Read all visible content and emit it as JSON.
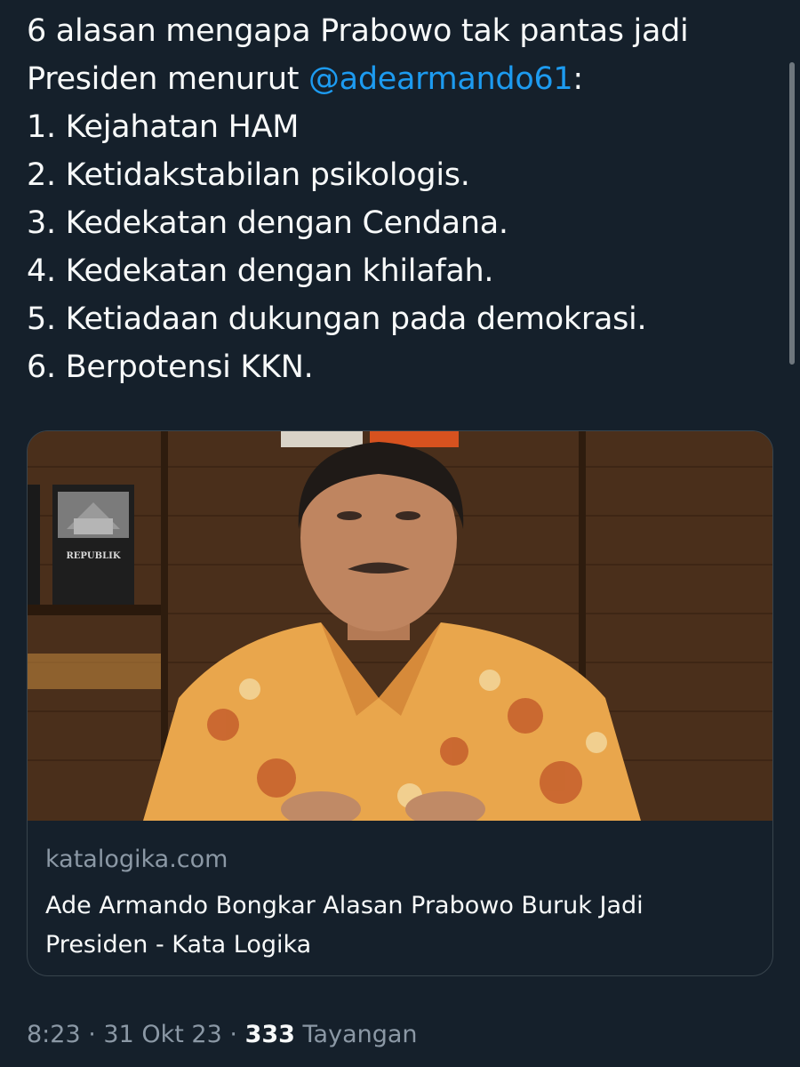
{
  "tweet": {
    "line1": "6 alasan mengapa Prabowo tak pantas jadi",
    "line2_prefix": "Presiden menurut ",
    "mention": "@adearmando61",
    "line2_suffix": ":",
    "list": [
      "1. Kejahatan HAM",
      "2. Ketidakstabilan psikologis.",
      "3. Kedekatan dengan Cendana.",
      "4. Kedekatan dengan khilafah.",
      "5. Ketiadaan dukungan pada demokrasi.",
      "6. Berpotensi KKN."
    ]
  },
  "card": {
    "book_title": "REPUBLIK",
    "domain": "katalogika.com",
    "title_line1": "Ade Armando Bongkar Alasan Prabowo Buruk Jadi",
    "title_line2": "Presiden - Kata Logika"
  },
  "meta": {
    "time": "8:23",
    "separator": "·",
    "date": "31 Okt 23",
    "views_count": "333",
    "views_label": "Tayangan"
  },
  "colors": {
    "background": "#15202b",
    "text": "#f7f9f9",
    "mention": "#1d9bf0",
    "secondary": "#8b98a5",
    "border": "#38444d"
  }
}
